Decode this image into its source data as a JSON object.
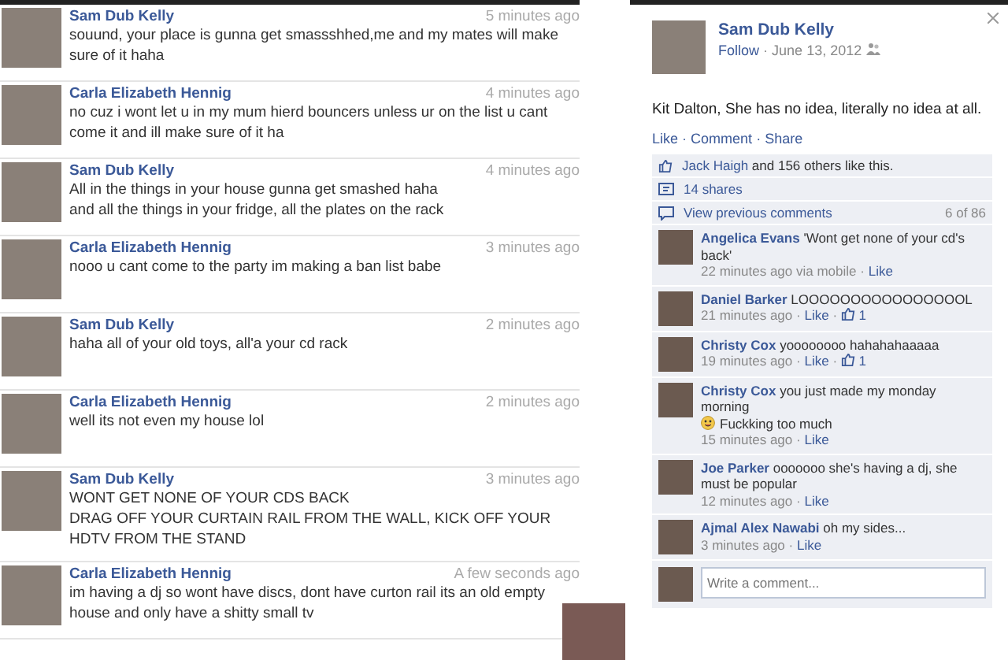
{
  "messages": [
    {
      "author": "Sam Dub Kelly",
      "time": "5 minutes ago",
      "lines": [
        "souund, your place is gunna get smassshhed,me and my mates will make sure of it haha"
      ]
    },
    {
      "author": "Carla Elizabeth Hennig",
      "time": "4 minutes ago",
      "lines": [
        "no cuz i wont let u in my mum hierd bouncers unless ur on the list u cant come it and ill make sure of it ha"
      ]
    },
    {
      "author": "Sam Dub Kelly",
      "time": "4 minutes ago",
      "lines": [
        "All in the things in your house gunna get smashed haha",
        "and all the things in your fridge, all the plates on the rack"
      ]
    },
    {
      "author": "Carla Elizabeth Hennig",
      "time": "3 minutes ago",
      "lines": [
        "nooo u cant come to the party im making a ban list babe"
      ]
    },
    {
      "author": "Sam Dub Kelly",
      "time": "2 minutes ago",
      "lines": [
        "haha all of your old toys, all'a your cd rack"
      ]
    },
    {
      "author": "Carla Elizabeth Hennig",
      "time": "2 minutes ago",
      "lines": [
        "well its not even my house lol"
      ]
    },
    {
      "author": "Sam Dub Kelly",
      "time": "3 minutes ago",
      "lines": [
        "WONT GET NONE OF YOUR CDS BACK",
        "DRAG OFF YOUR CURTAIN RAIL FROM THE WALL, KICK OFF YOUR HDTV FROM THE STAND"
      ]
    },
    {
      "author": "Carla Elizabeth Hennig",
      "time": "A few seconds ago",
      "lines": [
        "im having a dj so wont have discs, dont have curton rail its an old empty house and only have a shitty small tv"
      ]
    }
  ],
  "post": {
    "author": "Sam Dub Kelly",
    "follow": "Follow",
    "date": "June 13, 2012",
    "text": "Kit Dalton, She has no idea, literally no idea at all.",
    "actions": [
      "Like",
      "Comment",
      "Share"
    ],
    "likes": {
      "name": "Jack Haigh",
      "rest": "and 156 others like this."
    },
    "shares": "14 shares",
    "view_previous": "View previous comments",
    "count": "6 of 86",
    "comments": [
      {
        "author": "Angelica Evans",
        "text": "'Wont get none of your cd's back'",
        "time": "22 minutes ago via mobile",
        "like": "Like"
      },
      {
        "author": "Daniel Barker",
        "text": "LOOOOOOOOOOOOOOOOL",
        "time": "21 minutes ago",
        "like": "Like",
        "likes": "1"
      },
      {
        "author": "Christy Cox",
        "text": "yoooooooo hahahahaaaaa",
        "time": "19 minutes ago",
        "like": "Like",
        "likes": "1"
      },
      {
        "author": "Christy Cox",
        "text": "you just made my monday morning",
        "emoji_text": "Fuckking too much",
        "time": "15 minutes ago",
        "like": "Like"
      },
      {
        "author": "Joe Parker",
        "text": "ooooooo she's having a dj, she must be popular",
        "time": "12 minutes ago",
        "like": "Like"
      },
      {
        "author": "Ajmal Alex Nawabi",
        "text": "oh my sides...",
        "time": "3 minutes ago",
        "like": "Like"
      }
    ],
    "write_placeholder": "Write a comment...",
    "separator": "·"
  }
}
